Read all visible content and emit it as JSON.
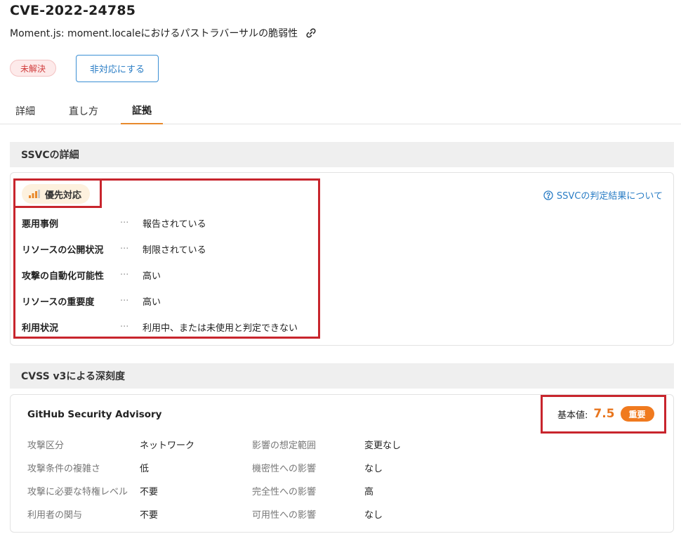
{
  "header": {
    "cve_id": "CVE-2022-24785",
    "subtitle": "Moment.js: moment.localeにおけるパストラバーサルの脆弱性",
    "status": "未解決",
    "action_button": "非対応にする"
  },
  "tabs": [
    {
      "label": "詳細"
    },
    {
      "label": "直し方"
    },
    {
      "label": "証拠",
      "active": true
    }
  ],
  "ssvc": {
    "section_title": "SSVCの詳細",
    "priority": "優先対応",
    "about_link": "SSVCの判定結果について",
    "rows": [
      {
        "label": "悪用事例",
        "sep": "···",
        "value": "報告されている"
      },
      {
        "label": "リソースの公開状況",
        "sep": "···",
        "value": "制限されている"
      },
      {
        "label": "攻撃の自動化可能性",
        "sep": "···",
        "value": "高い"
      },
      {
        "label": "リソースの重要度",
        "sep": "···",
        "value": "高い"
      },
      {
        "label": "利用状況",
        "sep": "···",
        "value": "利用中、または未使用と判定できない"
      }
    ]
  },
  "cvss": {
    "section_title": "CVSS v3による深刻度",
    "source": "GitHub Security Advisory",
    "base_label": "基本値:",
    "base_score": "7.5",
    "severity": "重要",
    "metrics_left": [
      {
        "label": "攻撃区分",
        "value": "ネットワーク"
      },
      {
        "label": "攻撃条件の複雑さ",
        "value": "低"
      },
      {
        "label": "攻撃に必要な特権レベル",
        "value": "不要"
      },
      {
        "label": "利用者の関与",
        "value": "不要"
      }
    ],
    "metrics_right": [
      {
        "label": "影響の想定範囲",
        "value": "変更なし"
      },
      {
        "label": "機密性への影響",
        "value": "なし"
      },
      {
        "label": "完全性への影響",
        "value": "高"
      },
      {
        "label": "可用性への影響",
        "value": "なし"
      }
    ]
  },
  "colors": {
    "accent_orange": "#e8892c",
    "link_blue": "#2a7dc5",
    "status_red": "#d03b3b",
    "annotation_red": "#c8252d"
  }
}
